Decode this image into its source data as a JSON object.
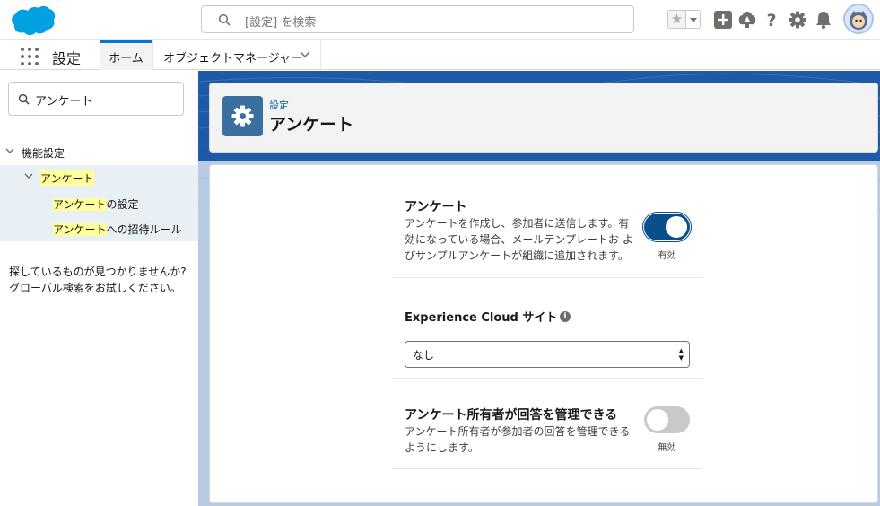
{
  "header": {
    "search_placeholder": "[設定] を検索"
  },
  "context_bar": {
    "app_name": "設定",
    "tabs": [
      {
        "label": "ホーム"
      },
      {
        "label": "オブジェクトマネージャー"
      }
    ]
  },
  "sidebar": {
    "quick_find_value": "アンケート",
    "tree": {
      "root": "機能設定",
      "group": "アンケート",
      "items": [
        {
          "highlight": "アンケート",
          "rest": "の設定"
        },
        {
          "highlight": "アンケート",
          "rest": "への招待ルール"
        }
      ]
    },
    "not_found_line1": "探しているものが見つかりませんか?",
    "not_found_line2": "グローバル検索をお試しください。"
  },
  "page_header": {
    "breadcrumb": "設定",
    "title": "アンケート"
  },
  "settings": {
    "surveys": {
      "title": "アンケート",
      "desc_lines": [
        "アンケートを作成し、参加者に送信します。有",
        "効になっている場合、メールテンプレートお よ",
        "びサンプルアンケートが組織に追加されます。"
      ],
      "toggle_label": "有効",
      "enabled": true
    },
    "experience_cloud": {
      "title": "Experience Cloud サイト",
      "selected": "なし"
    },
    "owner_manage": {
      "title": "アンケート所有者が回答を管理できる",
      "desc_lines": [
        "アンケート所有者が参加者の回答を管理できる",
        "ようにします。"
      ],
      "toggle_label": "無効",
      "enabled": false
    }
  },
  "colors": {
    "brand_blue": "#0176d3",
    "toggle_on": "#0b4f8a",
    "toggle_off": "#c9c9c9",
    "setup_icon_bg": "#3b6fa0",
    "highlight": "#ffff9c"
  }
}
